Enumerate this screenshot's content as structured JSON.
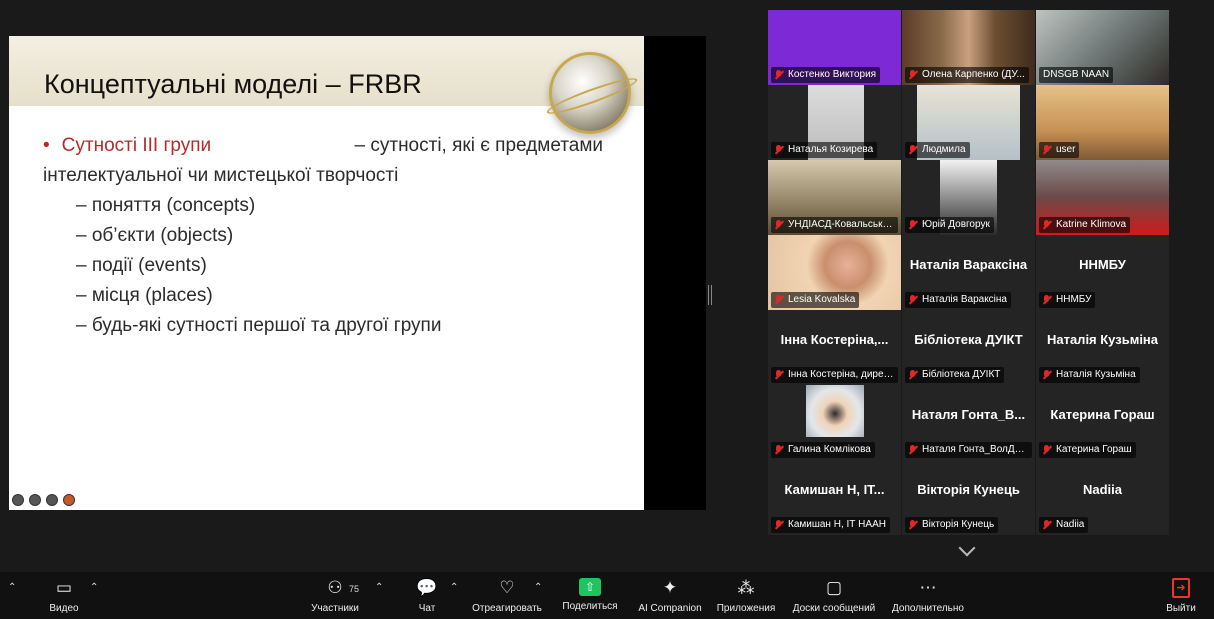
{
  "slide": {
    "title": "Концептуальні моделі – FRBR",
    "bullet_red": "Сутності III групи",
    "bullet_rest_line1": "– сутності, які є предметами",
    "bullet_line2": "інтелектуальної чи мистецької творчості",
    "subitems": [
      "– поняття (concepts)",
      "– об’єкти (objects)",
      "– події (events)",
      "– місця (places)",
      "– будь-які сутності першої та другої групи"
    ]
  },
  "participants": [
    {
      "label": "Костенко Виктория",
      "name": ""
    },
    {
      "label": "Олена Карпенко (ДУ...",
      "name": ""
    },
    {
      "label": "DNSGB NAAN",
      "name": "",
      "active": true
    },
    {
      "label": "Наталья Козирева",
      "name": ""
    },
    {
      "label": "Людмила",
      "name": ""
    },
    {
      "label": "user",
      "name": ""
    },
    {
      "label": "УНДІАСД-Ковальськи...",
      "name": ""
    },
    {
      "label": "Юрій Довгорук",
      "name": ""
    },
    {
      "label": "Katrine Klimova",
      "name": ""
    },
    {
      "label": "Lesia Kovalska",
      "name": ""
    },
    {
      "label": "Наталія Вараксіна",
      "name": "Наталія Вараксіна"
    },
    {
      "label": "ННМБУ",
      "name": "ННМБУ"
    },
    {
      "label": "Інна Костеріна, дирек...",
      "name": "Інна Костеріна,..."
    },
    {
      "label": "Бібліотека ДУІКТ",
      "name": "Бібліотека ДУІКТ"
    },
    {
      "label": "Наталія Кузьміна",
      "name": "Наталія Кузьміна"
    },
    {
      "label": "Галина Комлікова",
      "name": ""
    },
    {
      "label": "Наталя Гонта_ВолДСГ...",
      "name": "Наталя Гонта_В..."
    },
    {
      "label": "Катерина Гораш",
      "name": "Катерина Гораш"
    },
    {
      "label": "Камишан Н, ІТ НААН",
      "name": "Камишан Н, ІТ..."
    },
    {
      "label": "Вікторія Кунець",
      "name": "Вікторія Кунець"
    },
    {
      "label": "Nadiia",
      "name": "Nadiia"
    }
  ],
  "toolbar": {
    "video": "Видео",
    "participants": "Участники",
    "participants_count": "75",
    "chat": "Чат",
    "react": "Отреагировать",
    "share": "Поделиться",
    "ai": "AI Companion",
    "apps": "Приложения",
    "whiteboards": "Доски сообщений",
    "more": "Дополнительно",
    "leave": "Выйти"
  },
  "colors": {
    "active_border": "#3bd17f",
    "share_green": "#1ec45f",
    "muted_red": "#e02828",
    "slide_red": "#b52a2a"
  }
}
